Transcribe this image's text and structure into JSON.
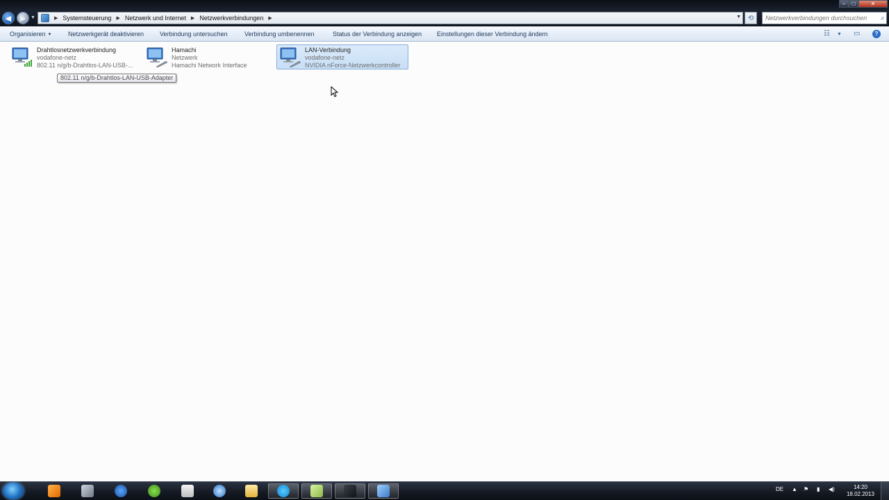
{
  "address_bar": {
    "breadcrumbs": [
      "Systemsteuerung",
      "Netzwerk und Internet",
      "Netzwerkverbindungen"
    ],
    "search_placeholder": "Netzwerkverbindungen durchsuchen"
  },
  "toolbar": {
    "organize": "Organisieren",
    "items": [
      "Netzwerkgerät deaktivieren",
      "Verbindung untersuchen",
      "Verbindung umbenennen",
      "Status der Verbindung anzeigen",
      "Einstellungen dieser Verbindung ändern"
    ]
  },
  "connections": [
    {
      "name": "Drahtlosnetzwerkverbindung",
      "network": "vodafone-netz",
      "device": "802.11 n/g/b-Drahtlos-LAN-USB-...",
      "icon": "wireless-network-icon",
      "selected": false
    },
    {
      "name": "Hamachi",
      "network": "Netzwerk",
      "device": "Hamachi Network Interface",
      "icon": "network-adapter-icon",
      "selected": false
    },
    {
      "name": "LAN-Verbindung",
      "network": "vodafone-netz",
      "device": "NVIDIA nForce-Netzwerkcontroller",
      "icon": "network-adapter-icon",
      "selected": true
    }
  ],
  "tooltip": "802.11 n/g/b-Drahtlos-LAN-USB-Adapter",
  "taskbar": {
    "apps": [
      "media-player-icon",
      "chat-icon",
      "reader-icon",
      "spotify-icon",
      "calculator-icon",
      "browser-icon",
      "explorer-icon",
      "skype-icon",
      "notes-icon",
      "tool-icon",
      "network-connections-icon"
    ],
    "language": "DE",
    "time": "14:20",
    "date": "18.02.2013"
  },
  "colors": {
    "toolbar_text": "#1e395b",
    "selection": "#c8dff6",
    "taskbar": "#141922"
  }
}
